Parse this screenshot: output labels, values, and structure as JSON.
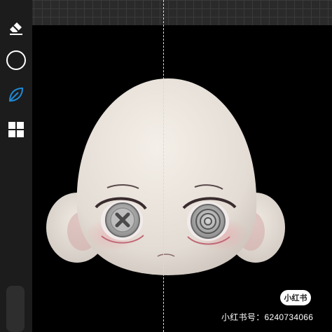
{
  "toolbar": {
    "tools": [
      {
        "name": "eraser-icon"
      },
      {
        "name": "brush-size-icon"
      },
      {
        "name": "smudge-leaf-icon",
        "active": true
      },
      {
        "name": "layers-grid-icon"
      }
    ],
    "active_color": "#1e8ad6"
  },
  "watermark": {
    "badge": "小红书",
    "caption": "小红书号：6240734066"
  }
}
